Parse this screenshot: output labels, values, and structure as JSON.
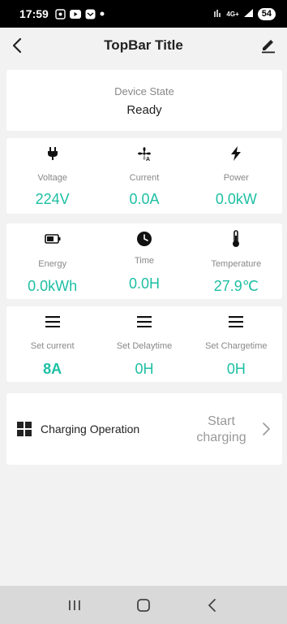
{
  "status_bar": {
    "time": "17:59",
    "network": "4G+",
    "battery": "54"
  },
  "topbar": {
    "title": "TopBar Title"
  },
  "device_state": {
    "label": "Device State",
    "value": "Ready"
  },
  "metrics": [
    {
      "label": "Voltage",
      "value": "224V",
      "icon": "plug-icon"
    },
    {
      "label": "Current",
      "value": "0.0A",
      "icon": "fan-current-icon"
    },
    {
      "label": "Power",
      "value": "0.0kW",
      "icon": "lightning-icon"
    },
    {
      "label": "Energy",
      "value": "0.0kWh",
      "icon": "battery-icon"
    },
    {
      "label": "Time",
      "value": "0.0H",
      "icon": "clock-icon"
    },
    {
      "label": "Temperature",
      "value": "27.9℃",
      "icon": "thermometer-icon"
    }
  ],
  "settings": [
    {
      "label": "Set current",
      "value": "8A",
      "icon": "menu-icon"
    },
    {
      "label": "Set Delaytime",
      "value": "0H",
      "icon": "menu-icon"
    },
    {
      "label": "Set Chargetime",
      "value": "0H",
      "icon": "menu-icon"
    }
  ],
  "operation": {
    "label": "Charging Operation",
    "action": "Start charging"
  },
  "colors": {
    "accent": "#1dbfa3",
    "label_gray": "#888888",
    "background": "#f2f2f2"
  }
}
